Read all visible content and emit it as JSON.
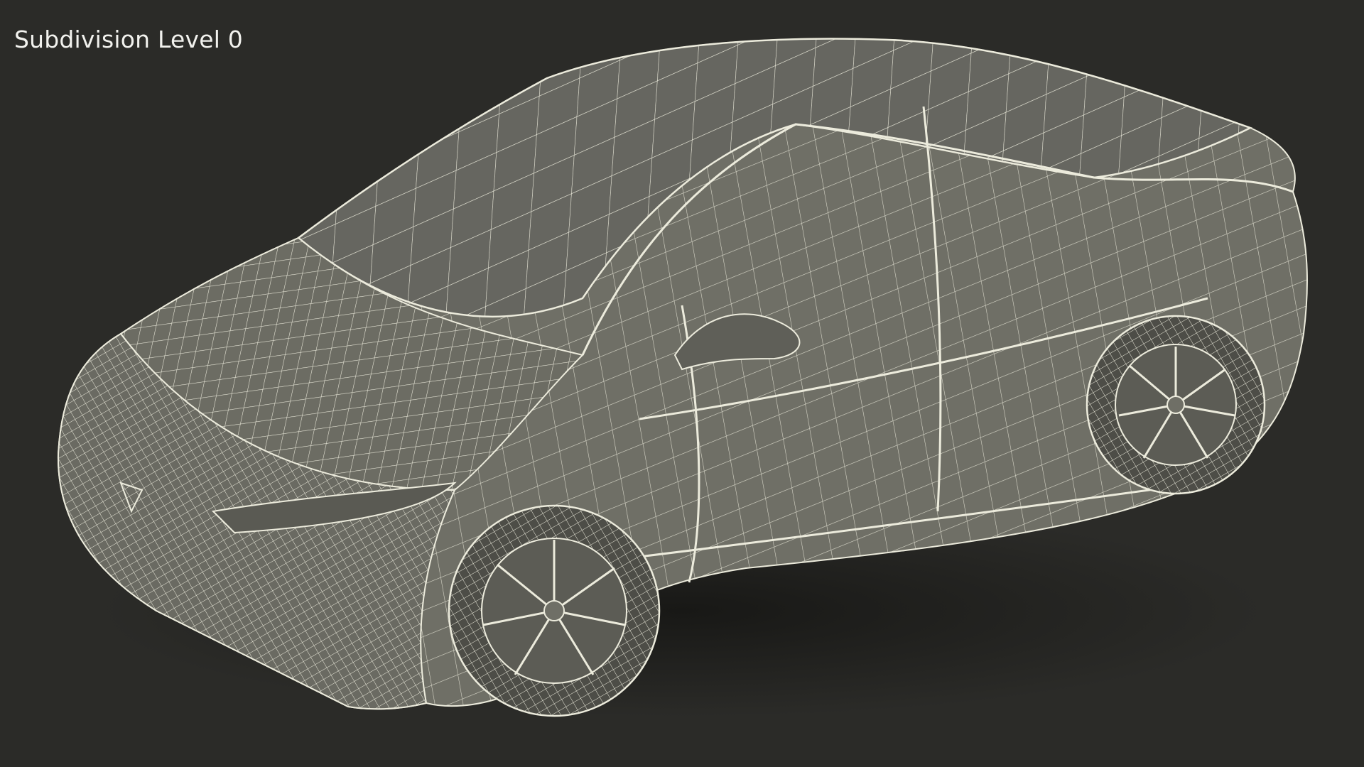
{
  "viewport": {
    "label": "Subdivision Level 0",
    "background_color": "#2b2b28",
    "surface_color": "#6f6f66",
    "wire_color": "#ecebdc",
    "shadow_color": "#1c1c1a"
  },
  "render": {
    "subject_icon": "car-wireframe-icon",
    "wheel_icon": "wheel-icon"
  }
}
